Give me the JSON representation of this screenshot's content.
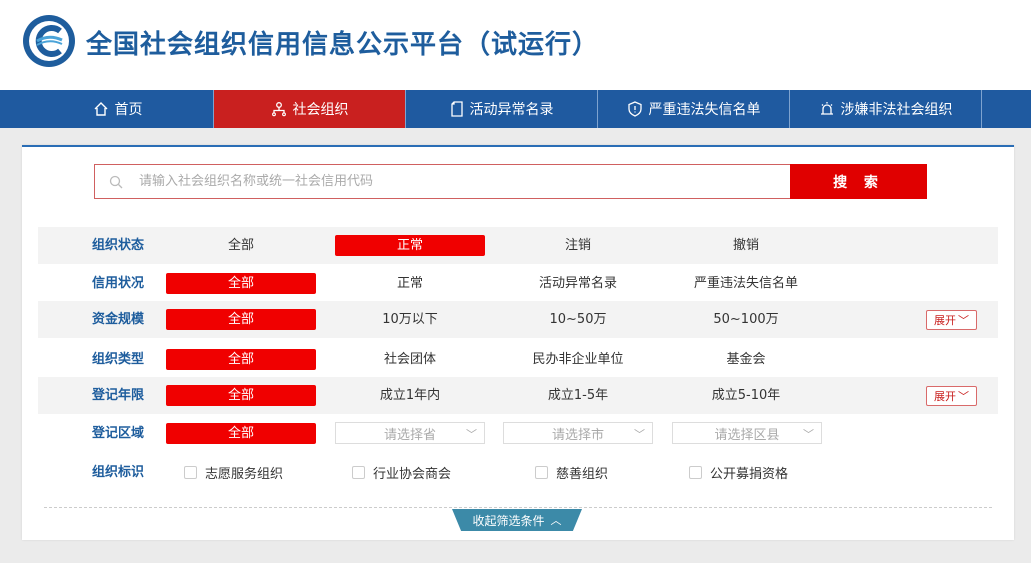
{
  "header": {
    "title": "全国社会组织信用信息公示平台（试运行）"
  },
  "nav": {
    "items": [
      {
        "label": "首页"
      },
      {
        "label": "社会组织"
      },
      {
        "label": "活动异常名录"
      },
      {
        "label": "严重违法失信名单"
      },
      {
        "label": "涉嫌非法社会组织"
      }
    ],
    "active": "社会组织"
  },
  "search": {
    "placeholder": "请输入社会组织名称或统一社会信用代码",
    "button_label": "搜 索"
  },
  "filters": {
    "status": {
      "label": "组织状态",
      "options": [
        "全部",
        "正常",
        "注销",
        "撤销"
      ],
      "selected": "正常"
    },
    "credit": {
      "label": "信用状况",
      "options": [
        "全部",
        "正常",
        "活动异常名录",
        "严重违法失信名单"
      ],
      "selected": "全部"
    },
    "capital": {
      "label": "资金规模",
      "options": [
        "全部",
        "10万以下",
        "10~50万",
        "50~100万"
      ],
      "selected": "全部",
      "expand_label": "展开"
    },
    "type": {
      "label": "组织类型",
      "options": [
        "全部",
        "社会团体",
        "民办非企业单位",
        "基金会"
      ],
      "selected": "全部"
    },
    "years": {
      "label": "登记年限",
      "options": [
        "全部",
        "成立1年内",
        "成立1-5年",
        "成立5-10年"
      ],
      "selected": "全部",
      "expand_label": "展开"
    },
    "region": {
      "label": "登记区域",
      "all": "全部",
      "province_placeholder": "请选择省",
      "city_placeholder": "请选择市",
      "county_placeholder": "请选择区县"
    },
    "tags": {
      "label": "组织标识",
      "options": [
        "志愿服务组织",
        "行业协会商会",
        "慈善组织",
        "公开募捐资格"
      ]
    }
  },
  "collapse_label": "收起筛选条件",
  "colors": {
    "brand_blue": "#1f5aa0",
    "accent_red": "#e00000",
    "label_blue": "#1e5d9d"
  }
}
